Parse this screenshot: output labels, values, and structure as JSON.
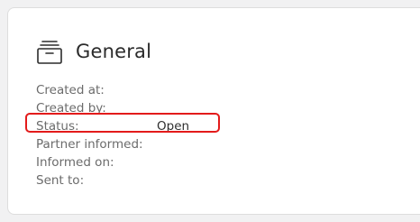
{
  "section": {
    "title": "General",
    "icon": "archive-box-icon"
  },
  "fields": [
    {
      "label": "Created at:",
      "value": ""
    },
    {
      "label": "Created by:",
      "value": ""
    },
    {
      "label": "Status:",
      "value": "Open"
    },
    {
      "label": "Partner informed:",
      "value": ""
    },
    {
      "label": "Informed on:",
      "value": ""
    },
    {
      "label": "Sent to:",
      "value": ""
    }
  ],
  "colors": {
    "highlight": "#e31b1b",
    "background": "#f1f1f2",
    "card": "#ffffff"
  }
}
